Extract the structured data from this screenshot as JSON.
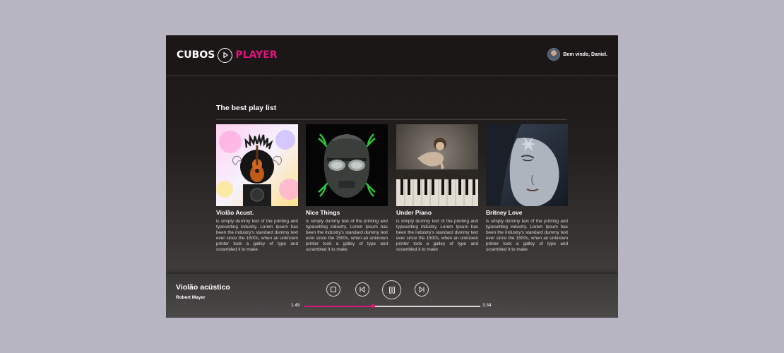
{
  "header": {
    "logo_left": "CUBOS",
    "logo_right": "PLAYER",
    "welcome": "Bem vindo, Daniel."
  },
  "playlist": {
    "title": "The best play list",
    "cards": [
      {
        "title": "Violão Acust.",
        "description": "is simply dummy text of the printing and typesetting industry. Lorem Ipsum has been the industry's standard dummy text ever since the 1500s, when an unknown printer took a galley of type and scrambled it to make",
        "image": "guitar-art"
      },
      {
        "title": "Nice Things",
        "description": "is simply dummy text of the printing and typesetting industry. Lorem Ipsum has been the industry's standard dummy text ever since the 1500s, when an unknown printer took a galley of type and scrambled it to make",
        "image": "mask-art"
      },
      {
        "title": "Under Piano",
        "description": "is simply dummy text of the printing and typesetting industry. Lorem Ipsum has been the industry's standard dummy text ever since the 1500s, when an unknown printer took a galley of type and scrambled it to make",
        "image": "piano-art"
      },
      {
        "title": "Britney Love",
        "description": "is simply dummy text of the printing and typesetting industry. Lorem Ipsum has been the industry's standard dummy text ever since the 1500s, when an unknown printer took a galley of type and scrambled it to make",
        "image": "face-art"
      }
    ]
  },
  "player": {
    "track_title": "Violão acústico",
    "artist": "Robert Mayer",
    "time_current": "1.45",
    "time_total": "3.34",
    "progress": 0.39,
    "controls": [
      "stop-icon",
      "previous-icon",
      "pause-icon",
      "next-icon"
    ]
  },
  "colors": {
    "accent": "#e3137e",
    "background": "#1b1717",
    "page_backdrop": "#b8b5c3"
  }
}
